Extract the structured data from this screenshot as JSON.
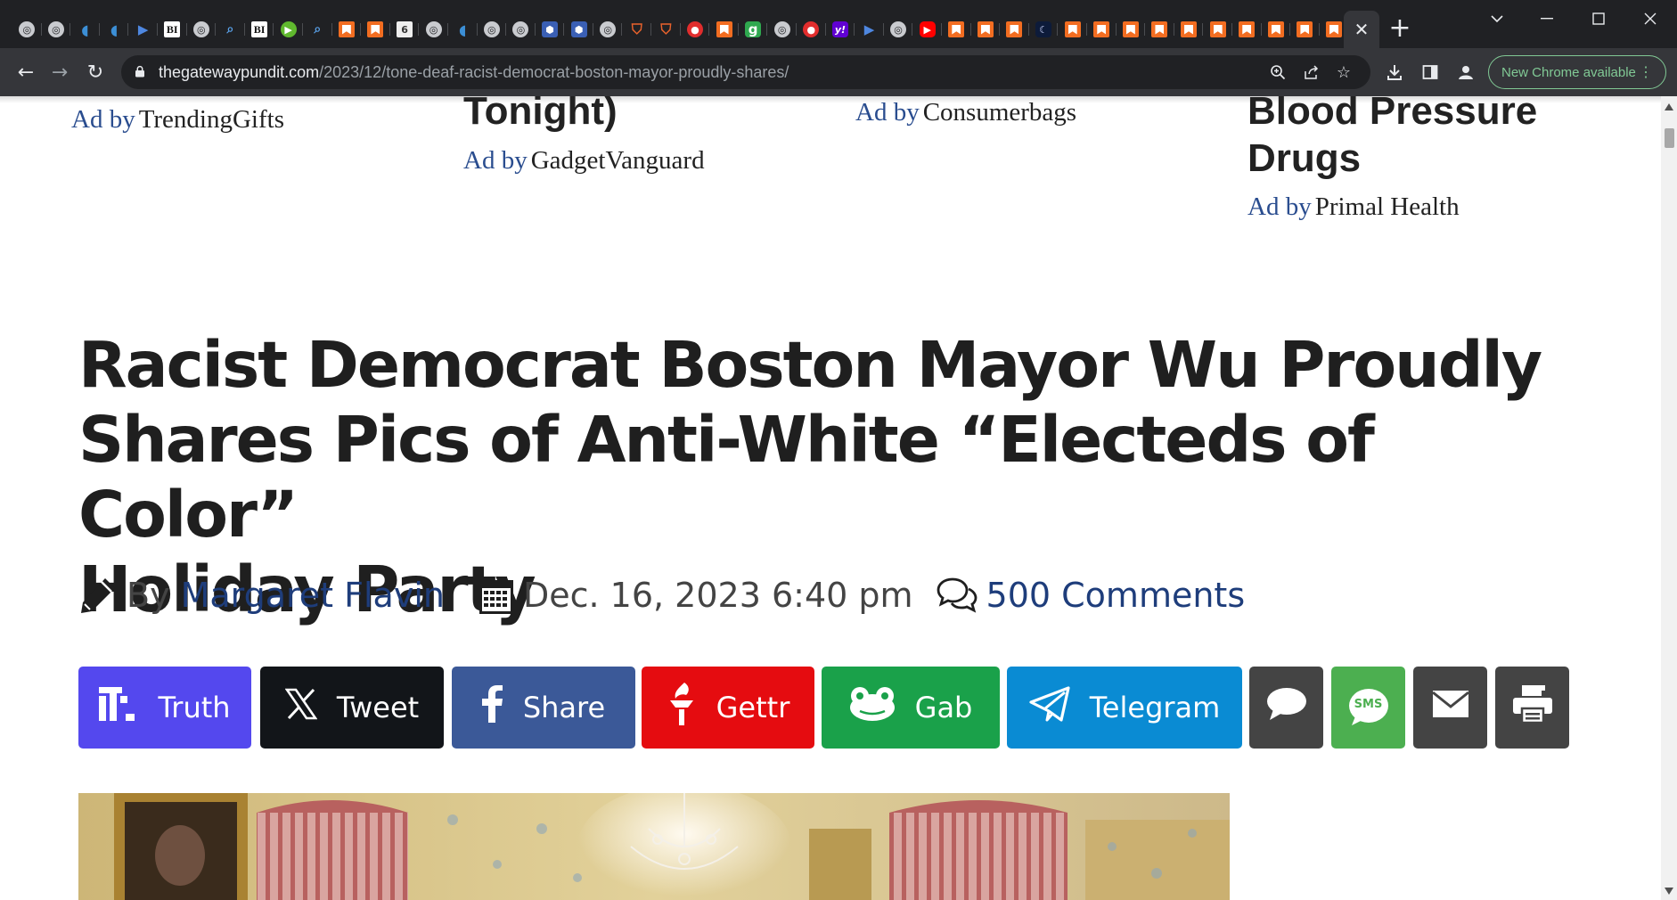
{
  "browser": {
    "tabs": [
      {
        "icon": "globe-icon"
      },
      {
        "icon": "globe-icon"
      },
      {
        "icon": "shield-icon"
      },
      {
        "icon": "shield-icon"
      },
      {
        "icon": "flag-icon"
      },
      {
        "icon": "bi-icon",
        "text": "BI"
      },
      {
        "icon": "globe-icon"
      },
      {
        "icon": "search-icon"
      },
      {
        "icon": "bi-icon",
        "text": "BI"
      },
      {
        "icon": "play-icon"
      },
      {
        "icon": "search-icon"
      },
      {
        "icon": "bookmark-icon"
      },
      {
        "icon": "bookmark-icon"
      },
      {
        "icon": "calendar-icon",
        "text": "6"
      },
      {
        "icon": "globe-icon"
      },
      {
        "icon": "shield-icon"
      },
      {
        "icon": "globe-icon"
      },
      {
        "icon": "globe-icon"
      },
      {
        "icon": "hex-icon"
      },
      {
        "icon": "hex-icon"
      },
      {
        "icon": "globe-icon"
      },
      {
        "icon": "brave-shield-icon"
      },
      {
        "icon": "brave-shield-icon"
      },
      {
        "icon": "pin-icon"
      },
      {
        "icon": "bookmark-icon"
      },
      {
        "icon": "g-icon",
        "text": "g"
      },
      {
        "icon": "globe-icon"
      },
      {
        "icon": "pin-icon"
      },
      {
        "icon": "yahoo-icon",
        "text": "y!"
      },
      {
        "icon": "flag-icon"
      },
      {
        "icon": "globe-icon"
      },
      {
        "icon": "youtube-icon"
      },
      {
        "icon": "bookmark-icon"
      },
      {
        "icon": "bookmark-icon"
      },
      {
        "icon": "bookmark-icon"
      },
      {
        "icon": "moon-icon"
      },
      {
        "icon": "bookmark-icon"
      },
      {
        "icon": "bookmark-icon"
      },
      {
        "icon": "bookmark-icon"
      },
      {
        "icon": "bookmark-icon"
      },
      {
        "icon": "bookmark-icon"
      },
      {
        "icon": "bookmark-icon"
      },
      {
        "icon": "bookmark-icon"
      },
      {
        "icon": "bookmark-icon"
      },
      {
        "icon": "bookmark-icon"
      },
      {
        "icon": "bookmark-icon"
      },
      {
        "icon": "bookmark-icon"
      }
    ],
    "new_tab_symbol": "+",
    "url_host": "thegatewaypundit.com",
    "url_path": "/2023/12/tone-deaf-racist-democrat-boston-mayor-proudly-shares/",
    "update_button": "New Chrome available",
    "accent": "#81c995"
  },
  "ads": {
    "by": "Ad by",
    "items": [
      {
        "source": "TrendingGifts"
      },
      {
        "headline_tail": "Tonight)",
        "source": "GadgetVanguard"
      },
      {
        "source": "Consumerbags"
      },
      {
        "headline_tail": [
          "Blood Pressure",
          "Drugs"
        ],
        "source": "Primal Health"
      }
    ]
  },
  "article": {
    "headline_lines": [
      "Racist Democrat Boston Mayor Wu Proudly",
      "Shares Pics of Anti-White “Electeds of Color”",
      "Holiday Party"
    ],
    "by_label": "By",
    "author": "Margaret Flavin",
    "date": "Dec. 16, 2023 6:40 pm",
    "comments": "500 Comments"
  },
  "share_buttons": [
    {
      "label": "Truth",
      "color": "#5448ee"
    },
    {
      "label": "Tweet",
      "color": "#121519"
    },
    {
      "label": "Share",
      "color": "#3b5998"
    },
    {
      "label": "Gettr",
      "color": "#e50c10"
    },
    {
      "label": "Gab",
      "color": "#1aa14a"
    },
    {
      "label": "Telegram",
      "color": "#0a8bd3"
    },
    {
      "label": "",
      "color": "#444444",
      "icon": "chat-icon"
    },
    {
      "label": "SMS",
      "color": "#4caf50",
      "icon": "sms-icon"
    },
    {
      "label": "",
      "color": "#444444",
      "icon": "email-icon"
    },
    {
      "label": "",
      "color": "#444444",
      "icon": "print-icon"
    }
  ]
}
